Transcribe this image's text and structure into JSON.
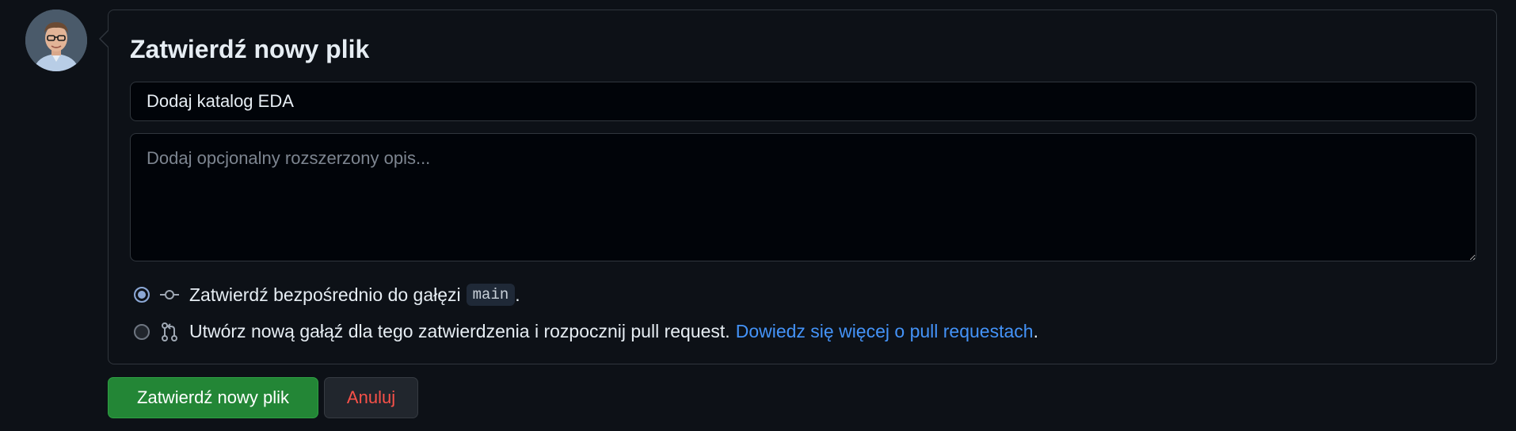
{
  "commit_form": {
    "title": "Zatwierdź nowy plik",
    "summary_value": "Dodaj katalog EDA",
    "description_placeholder": "Dodaj opcjonalny rozszerzony opis...",
    "option_direct": {
      "label": "Zatwierdź bezpośrednio do gałęzi",
      "branch": "main",
      "suffix": ".",
      "selected": true
    },
    "option_new_branch": {
      "label": "Utwórz nową gałąź dla tego zatwierdzenia i rozpocznij pull request.",
      "link_text": "Dowiedz się więcej o pull requestach",
      "suffix": ".",
      "selected": false
    }
  },
  "buttons": {
    "commit_label": "Zatwierdź nowy plik",
    "cancel_label": "Anuluj"
  },
  "icons": {
    "direct_commit": "git-commit-icon",
    "new_branch": "git-pull-request-icon",
    "avatar": "user-avatar"
  },
  "colors": {
    "background": "#0d1117",
    "commit_button": "#238636",
    "cancel_text": "#f85149",
    "link": "#4493f8"
  }
}
